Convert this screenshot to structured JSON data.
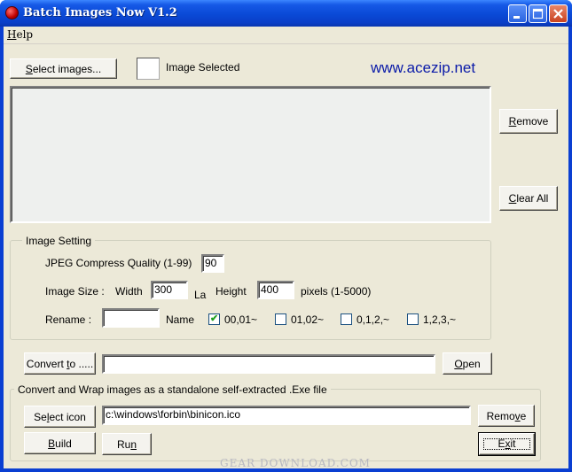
{
  "window": {
    "title": "Batch Images Now V1.2",
    "minimize_icon": "minimize-icon",
    "maximize_icon": "maximize-icon",
    "close_icon": "close-icon"
  },
  "menu": {
    "help_pre": "",
    "help_hot": "H",
    "help_post": "elp"
  },
  "top": {
    "select_pre": "",
    "select_hot": "S",
    "select_post": "elect images...",
    "image_selected_label": "Image Selected",
    "website": "www.acezip.net"
  },
  "side_buttons": {
    "remove_pre": "",
    "remove_hot": "R",
    "remove_post": "emove",
    "clear_pre": "",
    "clear_hot": "C",
    "clear_post": "lear All"
  },
  "image_setting": {
    "title": "Image Setting",
    "quality_label": "JPEG Compress Quality (1-99)",
    "quality_value": "90",
    "size_label": "Image Size :",
    "width_label": "Width",
    "width_value": "300",
    "link_label": "La",
    "height_label": "Height",
    "height_value": "400",
    "pixels_label": "pixels (1-5000)",
    "rename_label": "Rename :",
    "rename_value": "",
    "name_label": "Name",
    "options": [
      {
        "label": "00,01~",
        "checked": true
      },
      {
        "label": "01,02~",
        "checked": false
      },
      {
        "label": "0,1,2,~",
        "checked": false
      },
      {
        "label": "1,2,3,~",
        "checked": false
      }
    ]
  },
  "convert": {
    "convert_pre": "Convert ",
    "convert_hot": "t",
    "convert_post": "o .....",
    "path_value": "",
    "open_pre": "",
    "open_hot": "O",
    "open_post": "pen"
  },
  "wrap": {
    "title": "Convert and Wrap images as a standalone self-extracted .Exe file",
    "icon_pre": "Se",
    "icon_hot": "l",
    "icon_post": "ect icon",
    "icon_path": "c:\\windows\\forbin\\binicon.ico",
    "remove_pre": "Remo",
    "remove_hot": "v",
    "remove_post": "e",
    "build_pre": "",
    "build_hot": "B",
    "build_post": "uild",
    "run_pre": "Ru",
    "run_hot": "n",
    "run_post": "",
    "exit_pre": "E",
    "exit_hot": "x",
    "exit_post": "it"
  },
  "watermark": "GEAR DOWNLOAD.COM"
}
